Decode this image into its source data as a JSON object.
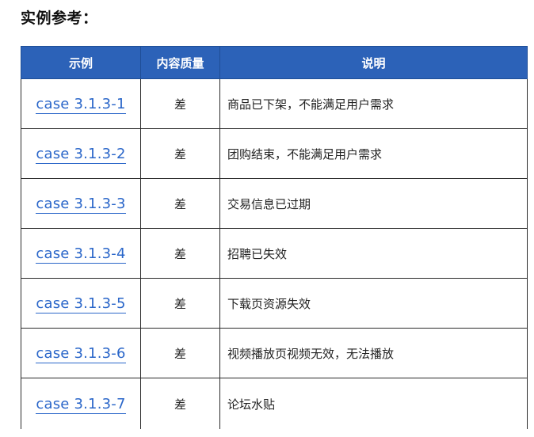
{
  "heading": "实例参考：",
  "table": {
    "headers": [
      "示例",
      "内容质量",
      "说明"
    ],
    "rows": [
      {
        "example": "case 3.1.3-1",
        "quality": "差",
        "desc": "商品已下架，不能满足用户需求"
      },
      {
        "example": "case 3.1.3-2",
        "quality": "差",
        "desc": "团购结束，不能满足用户需求"
      },
      {
        "example": "case 3.1.3-3",
        "quality": "差",
        "desc": "交易信息已过期"
      },
      {
        "example": "case 3.1.3-4",
        "quality": "差",
        "desc": "招聘已失效"
      },
      {
        "example": "case 3.1.3-5",
        "quality": "差",
        "desc": "下载页资源失效"
      },
      {
        "example": "case 3.1.3-6",
        "quality": "差",
        "desc": "视频播放页视频无效，无法播放"
      },
      {
        "example": "case 3.1.3-7",
        "quality": "差",
        "desc": "论坛水贴"
      }
    ]
  },
  "colors": {
    "header_bg": "#2c62b8",
    "link": "#2a66c9",
    "border": "#2b2b2b"
  }
}
